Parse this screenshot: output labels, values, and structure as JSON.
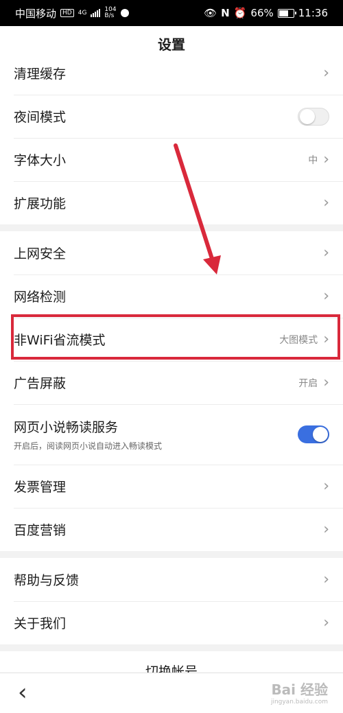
{
  "status_bar": {
    "carrier": "中国移动",
    "hd": "HD",
    "network": "4G",
    "speed_value": "104",
    "speed_unit": "B/s",
    "battery": "66%",
    "time": "11:36"
  },
  "header": {
    "title": "设置"
  },
  "groups": [
    {
      "rows": [
        {
          "label": "清理缓存",
          "type": "chevron"
        },
        {
          "label": "夜间模式",
          "type": "toggle",
          "on": false
        },
        {
          "label": "字体大小",
          "type": "chevron",
          "value": "中"
        },
        {
          "label": "扩展功能",
          "type": "chevron"
        }
      ]
    },
    {
      "rows": [
        {
          "label": "上网安全",
          "type": "chevron"
        },
        {
          "label": "网络检测",
          "type": "chevron"
        },
        {
          "label": "非WiFi省流模式",
          "type": "chevron",
          "value": "大图模式"
        },
        {
          "label": "广告屏蔽",
          "type": "chevron",
          "value": "开启"
        },
        {
          "label": "网页小说畅读服务",
          "type": "toggle",
          "on": true,
          "sub": "开启后，阅读网页小说自动进入畅读模式"
        },
        {
          "label": "发票管理",
          "type": "chevron"
        },
        {
          "label": "百度营销",
          "type": "chevron"
        }
      ]
    },
    {
      "rows": [
        {
          "label": "帮助与反馈",
          "type": "chevron"
        },
        {
          "label": "关于我们",
          "type": "chevron"
        }
      ]
    }
  ],
  "switch_account": "切换帐号",
  "nav": {
    "back_icon": "back-icon"
  },
  "watermark": {
    "text": "Bai 经验",
    "sub": "jingyan.baidu.com"
  },
  "colors": {
    "accent": "#3a6fe0",
    "annotation": "#d9293b"
  },
  "chevron_glyph": "›"
}
